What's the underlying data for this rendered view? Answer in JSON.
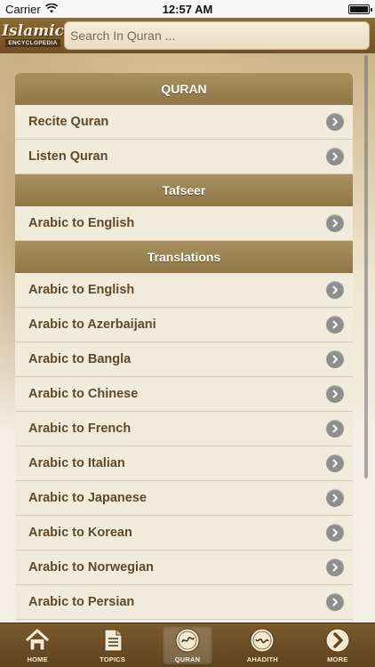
{
  "status_bar": {
    "carrier": "Carrier",
    "time": "12:57 AM",
    "battery_level": 1.0
  },
  "header": {
    "logo_main": "Islamic",
    "logo_sub": "ENCYCLOPEDIA",
    "search_placeholder": "Search In Quran ..."
  },
  "sections": [
    {
      "title": "QURAN",
      "items": [
        "Recite Quran",
        "Listen Quran"
      ]
    },
    {
      "title": "Tafseer",
      "items": [
        "Arabic to English"
      ]
    },
    {
      "title": "Translations",
      "items": [
        "Arabic to English",
        "Arabic to Azerbaijani",
        "Arabic to Bangla",
        "Arabic to Chinese",
        "Arabic to French",
        "Arabic to Italian",
        "Arabic to Japanese",
        "Arabic to Korean",
        "Arabic to Norwegian",
        "Arabic to Persian"
      ]
    }
  ],
  "tabbar": {
    "tabs": [
      {
        "label": "HOME",
        "icon": "home-icon"
      },
      {
        "label": "TOPICS",
        "icon": "document-icon"
      },
      {
        "label": "QURAN",
        "icon": "quran-seal-icon",
        "active": true
      },
      {
        "label": "AHADITH",
        "icon": "ahadith-seal-icon"
      },
      {
        "label": "MORE",
        "icon": "chevron-right-icon"
      }
    ]
  },
  "colors": {
    "header_brown": "#7a5a2d",
    "section_header": "#9c8352",
    "row_background": "#f1ebdc",
    "row_text": "#5d4a2c"
  }
}
